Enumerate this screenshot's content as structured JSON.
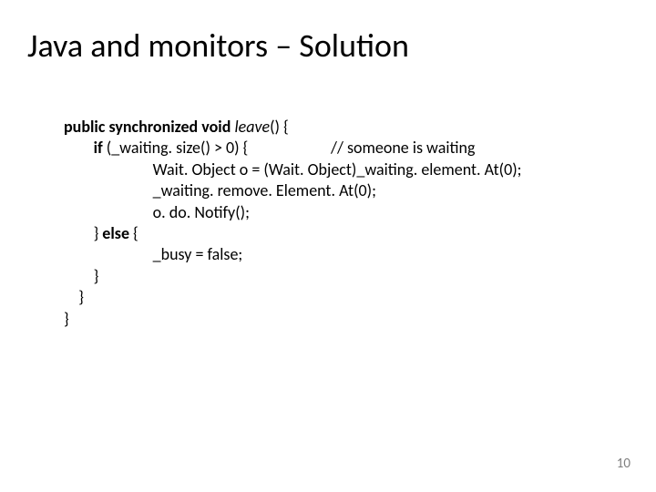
{
  "title": "Java and monitors – Solution",
  "code": {
    "kw_public": "public",
    "kw_synchronized": "synchronized",
    "kw_void": "void",
    "method_name": "leave",
    "sig_tail": "() {",
    "kw_if": "if",
    "if_cond": " (_waiting. size() > 0) {",
    "comment": "// someone is waiting",
    "line_obj": "Wait. Object o = (Wait. Object)_waiting. element. At(0);",
    "line_remove": "_waiting. remove. Element. At(0);",
    "line_notify": "o. do. Notify();",
    "kw_else_open": "} ",
    "kw_else": "else",
    "kw_else_close": " {",
    "line_busy": "_busy = false;",
    "brace_inner": "}",
    "brace_method": "}",
    "brace_class": "}"
  },
  "page_number": "10"
}
